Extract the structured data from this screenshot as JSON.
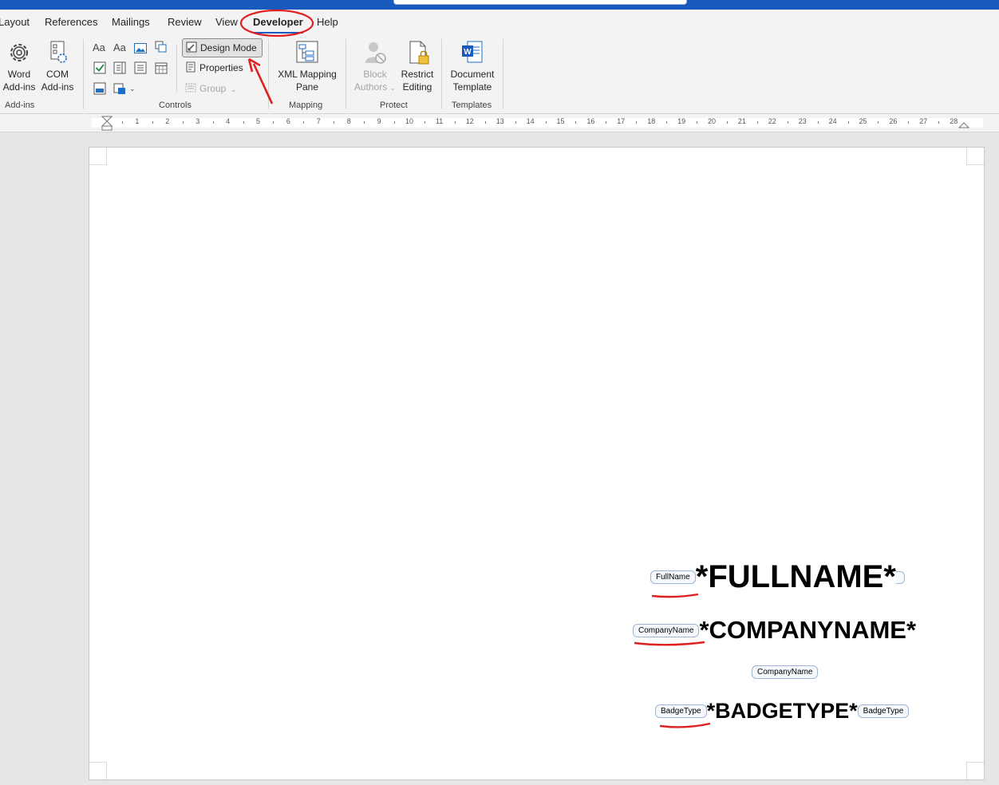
{
  "tabs": [
    {
      "label": "Layout"
    },
    {
      "label": "References"
    },
    {
      "label": "Mailings"
    },
    {
      "label": "Review"
    },
    {
      "label": "View"
    },
    {
      "label": "Developer",
      "active": true
    },
    {
      "label": "Help"
    }
  ],
  "ribbon": {
    "addins": {
      "word_addins": [
        "Word",
        "Add-ins"
      ],
      "com_addins": [
        "COM",
        "Add-ins"
      ],
      "group_label": "Add-ins"
    },
    "controls": {
      "design_mode": "Design Mode",
      "properties": "Properties",
      "group": "Group",
      "group_label": "Controls",
      "rich_text_glyph": "Aa",
      "plain_text_glyph": "Aa"
    },
    "mapping": {
      "xml_mapping": [
        "XML Mapping",
        "Pane"
      ],
      "group_label": "Mapping"
    },
    "protect": {
      "block_authors": [
        "Block",
        "Authors"
      ],
      "restrict_editing": [
        "Restrict",
        "Editing"
      ],
      "group_label": "Protect"
    },
    "templates": {
      "document_template": [
        "Document",
        "Template"
      ],
      "group_label": "Templates"
    }
  },
  "ruler": {
    "numbers": [
      "1",
      "2",
      "3",
      "4",
      "5",
      "6",
      "7",
      "8",
      "9",
      "10",
      "11",
      "12",
      "13",
      "14",
      "15",
      "16",
      "17",
      "18",
      "19",
      "20",
      "21",
      "22",
      "23",
      "24",
      "25",
      "26",
      "27",
      "28"
    ]
  },
  "document": {
    "fullname": {
      "tag": "FullName",
      "text": "*FULLNAME*"
    },
    "companyname": {
      "tag": "CompanyName",
      "text": "*COMPANYNAME*"
    },
    "companyname_empty": {
      "tag": "CompanyName"
    },
    "badgetype": {
      "tag": "BadgeType",
      "text": "*BADGETYPE*",
      "end_tag": "BadgeType"
    }
  },
  "colors": {
    "accent": "#185abd",
    "annotation": "#e02020"
  }
}
